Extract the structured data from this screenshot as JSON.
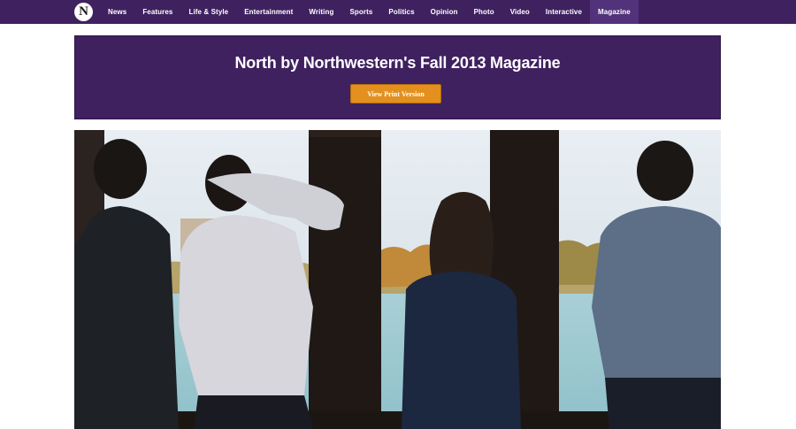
{
  "nav": {
    "logo_letter": "N",
    "items": [
      {
        "label": "News"
      },
      {
        "label": "Features"
      },
      {
        "label": "Life & Style"
      },
      {
        "label": "Entertainment"
      },
      {
        "label": "Writing"
      },
      {
        "label": "Sports"
      },
      {
        "label": "Politics"
      },
      {
        "label": "Opinion"
      },
      {
        "label": "Photo"
      },
      {
        "label": "Video"
      },
      {
        "label": "Interactive"
      },
      {
        "label": "Magazine"
      }
    ],
    "active": "Magazine"
  },
  "banner": {
    "title": "North by Northwestern's Fall 2013 Magazine",
    "button_label": "View Print Version"
  },
  "colors": {
    "brand_purple": "#3f2160",
    "button_orange": "#e4901e"
  },
  "hero": {
    "icon": "cover-photo"
  }
}
